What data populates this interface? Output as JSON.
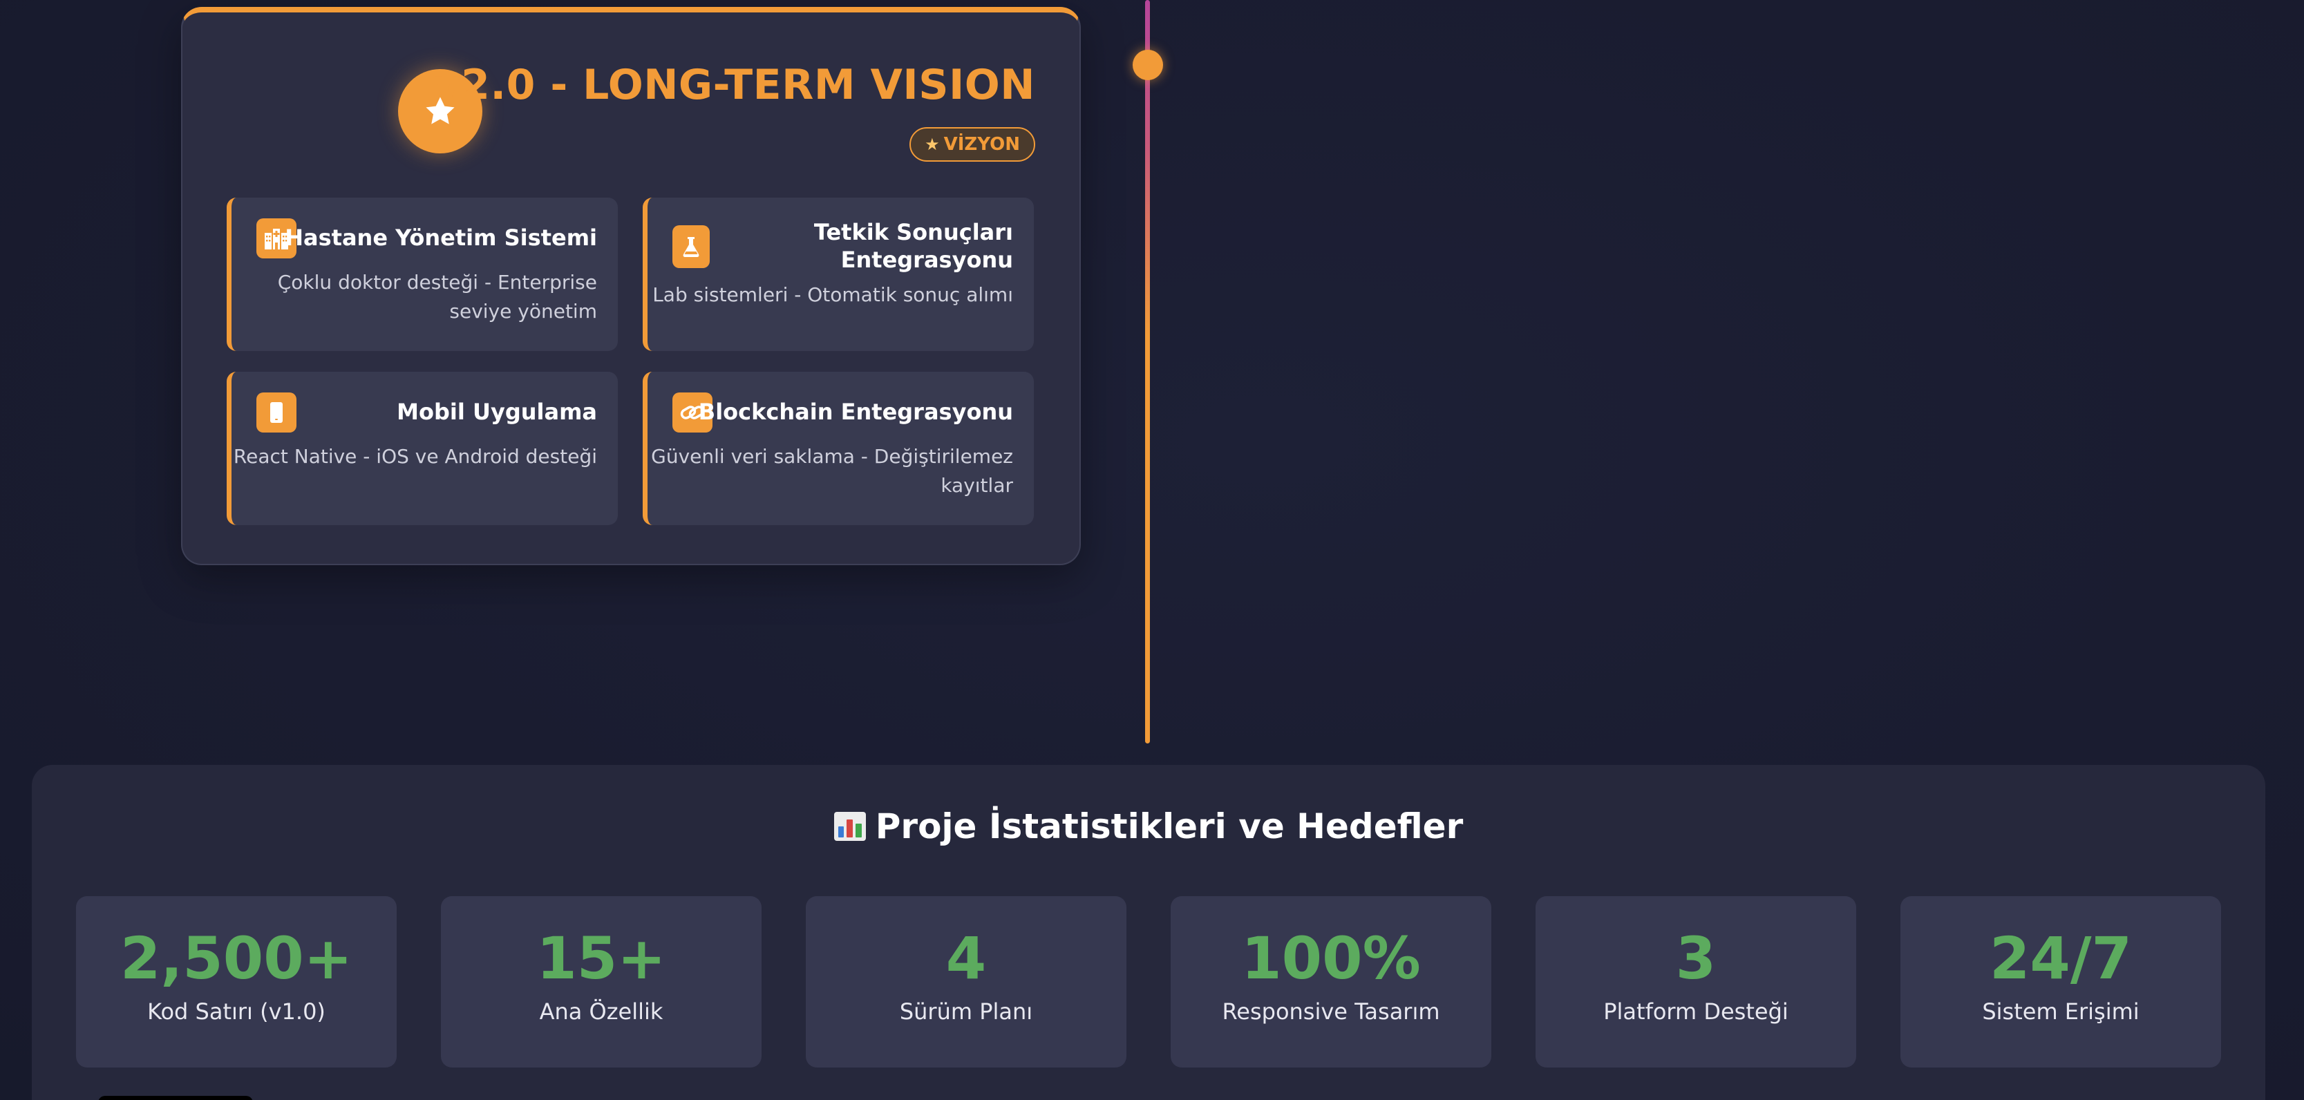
{
  "version_card": {
    "title": "v2.0 - LONG-TERM VISION",
    "icon": "star-icon",
    "badge": "VİZYON",
    "badge_icon": "star-icon",
    "accent_color": "#f29b38",
    "features": [
      {
        "icon": "hospital-icon",
        "title": "Hastane Yönetim Sistemi",
        "desc_line1": "Çoklu doktor desteği - Enterprise",
        "desc_line2": "seviye yönetim"
      },
      {
        "icon": "flask-icon",
        "title_line1": "Tetkik Sonuçları",
        "title_line2": "Entegrasyonu",
        "desc_line1": "Lab sistemleri - Otomatik sonuç alımı"
      },
      {
        "icon": "mobile-phone-icon",
        "title": "Mobil Uygulama",
        "desc_line1": "React Native - iOS ve Android desteği"
      },
      {
        "icon": "link-icon",
        "title": "Blockchain Entegrasyonu",
        "desc_line1": "Güvenli veri saklama - Değiştirilemez",
        "desc_line2": "kayıtlar"
      }
    ]
  },
  "stats": {
    "icon": "bar-chart-icon",
    "title": "Proje İstatistikleri ve Hedefler",
    "value_color": "#5cab5e",
    "items": [
      {
        "value": "2,500+",
        "label": "Kod Satırı (v1.0)"
      },
      {
        "value": "15+",
        "label": "Ana Özellik"
      },
      {
        "value": "4",
        "label": "Sürüm Planı"
      },
      {
        "value": "100%",
        "label": "Responsive Tasarım"
      },
      {
        "value": "3",
        "label": "Platform Desteği"
      },
      {
        "value": "24/7",
        "label": "Sistem Erişimi"
      }
    ]
  }
}
